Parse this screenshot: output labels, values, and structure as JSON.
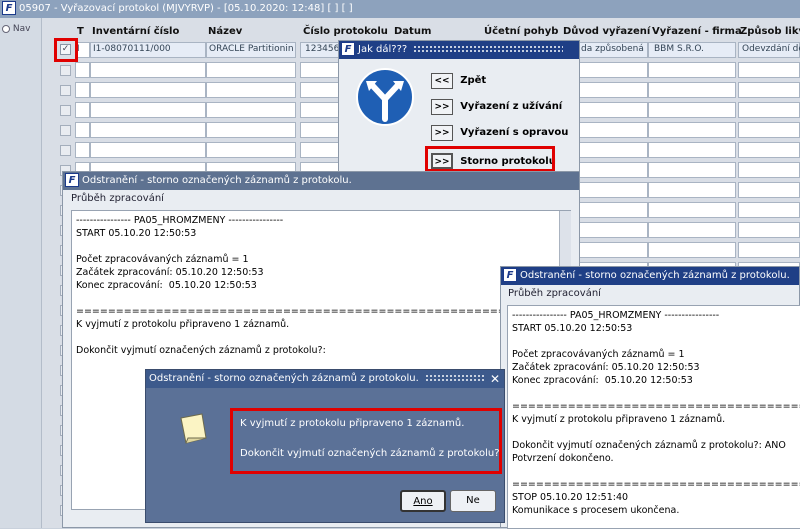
{
  "window": {
    "title": "05907 - Vyřazovací protokol (MJVYRVP) - [05.10.2020: 12:48] [ ] [ ]"
  },
  "nav": {
    "label": "Nav"
  },
  "grid": {
    "columns": [
      "T",
      "Inventární číslo",
      "Název",
      "Číslo protokolu",
      "Datum",
      "Účetní pohyb",
      "Důvod vyřazení",
      "Vyřazení - firma",
      "Způsob likvi"
    ],
    "row1": {
      "t": "I",
      "inv": "I1-08070111/000",
      "name": "ORACLE Partitionin",
      "protocol": "123456",
      "duvod": "da způsobená",
      "firma": "BBM S.R.O.",
      "zpusob": "Odevzdání de"
    }
  },
  "jakdal": {
    "title": "Jak dál???",
    "items": [
      {
        "btn": "<<",
        "label": "Zpět"
      },
      {
        "btn": ">>",
        "label": "Vyřazení z užívání"
      },
      {
        "btn": ">>",
        "label": "Vyřazení s opravou"
      },
      {
        "btn": ">>",
        "label": "Storno protokolu"
      }
    ]
  },
  "progress1": {
    "title": "Odstranění - storno označených záznamů z protokolu.",
    "section": "Průběh zpracování",
    "log": "---------------- PA05_HROMZMENY ----------------\nSTART 05.10.20 12:50:53\n\nPočet zpracovávaných záznamů = 1\nZačátek zpracování: 05.10.20 12:50:53\nKonec zpracování:  05.10.20 12:50:53\n\n=========================================================\nK vyjmutí z protokolu připraveno 1 záznamů.\n\nDokončit vyjmutí označených záznamů z protokolu?:"
  },
  "progress2": {
    "title": "Odstranění - storno označených záznamů z protokolu.",
    "section": "Průběh zpracování",
    "log": "---------------- PA05_HROMZMENY ----------------\nSTART 05.10.20 12:50:53\n\nPočet zpracovávaných záznamů = 1\nZačátek zpracování: 05.10.20 12:50:53\nKonec zpracování:  05.10.20 12:50:53\n\n=========================================================\nK vyjmutí z protokolu připraveno 1 záznamů.\n\nDokončit vyjmutí označených záznamů z protokolu?: ANO\nPotvrzení dokončeno.\n\n=========================================================\nSTOP 05.10.20 12:51:40\nKomunikace s procesem ukončena."
  },
  "confirm": {
    "title": "Odstranění - storno označených záznamů z protokolu.",
    "close": "✕",
    "line1": "K vyjmutí z protokolu připraveno 1 záznamů.",
    "line2": "Dokončit vyjmutí označených záznamů z protokolu?:",
    "yes": "Ano",
    "no": "Ne"
  }
}
